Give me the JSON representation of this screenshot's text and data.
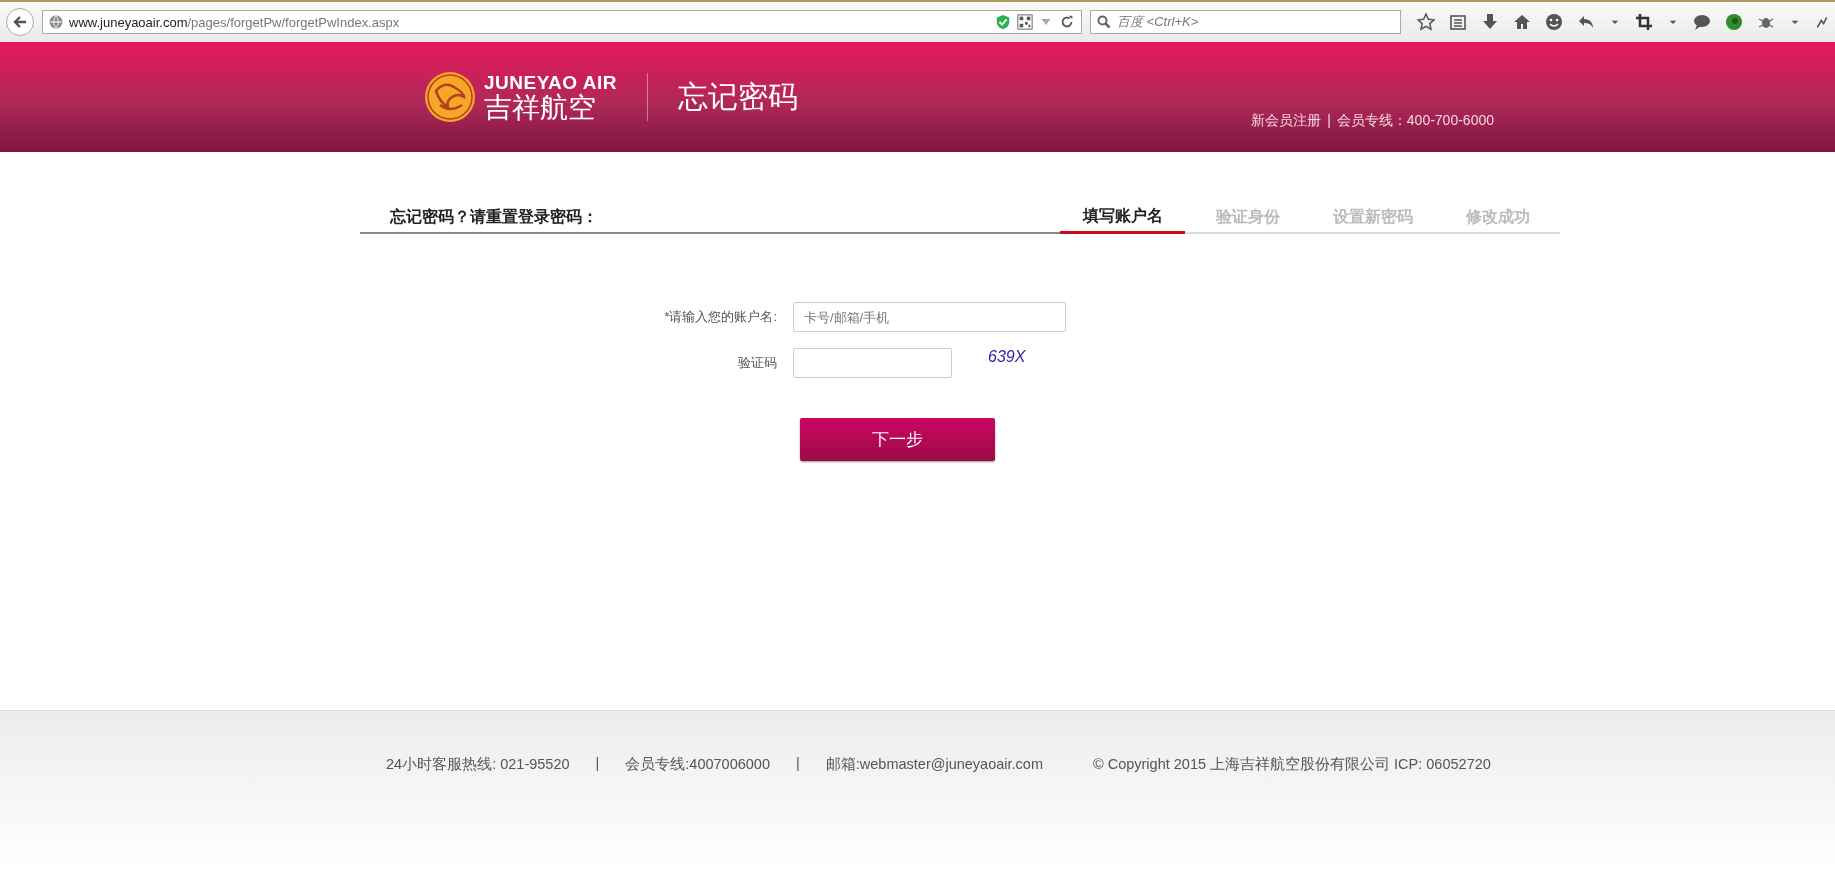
{
  "browser": {
    "url_domain": "www.juneyaoair.com",
    "url_path": "/pages/forgetPw/forgetPwIndex.aspx",
    "search_placeholder": "百度 <Ctrl+K>"
  },
  "header": {
    "logo_en": "JUNEYAO AIR",
    "logo_cn": "吉祥航空",
    "title": "忘记密码",
    "register": "新会员注册",
    "separator": "|",
    "hotline": "会员专线：400-700-6000"
  },
  "steps": {
    "heading": "忘记密码？请重置登录密码：",
    "items": [
      {
        "label": "填写账户名",
        "selected": true
      },
      {
        "label": "验证身份",
        "selected": false
      },
      {
        "label": "设置新密码",
        "selected": false
      },
      {
        "label": "修改成功",
        "selected": false
      }
    ]
  },
  "form": {
    "fields": [
      {
        "kind": "text",
        "label": "*请输入您的账户名:",
        "placeholder": "卡号/邮箱/手机"
      },
      {
        "kind": "captcha",
        "label": "验证码",
        "captcha": "639X"
      }
    ],
    "submit": "下一步"
  },
  "footer": {
    "items": [
      {
        "kind": "text",
        "text": "24小时客服热线: 021-95520"
      },
      {
        "kind": "separator",
        "text": "|"
      },
      {
        "kind": "text",
        "text": "会员专线:4007006000"
      },
      {
        "kind": "separator",
        "text": "|"
      },
      {
        "kind": "text",
        "text": "邮箱:webmaster@juneyaoair.com"
      },
      {
        "kind": "copyright",
        "text": "© Copyright 2015 上海吉祥航空股份有限公司 ICP: 06052720"
      }
    ]
  }
}
